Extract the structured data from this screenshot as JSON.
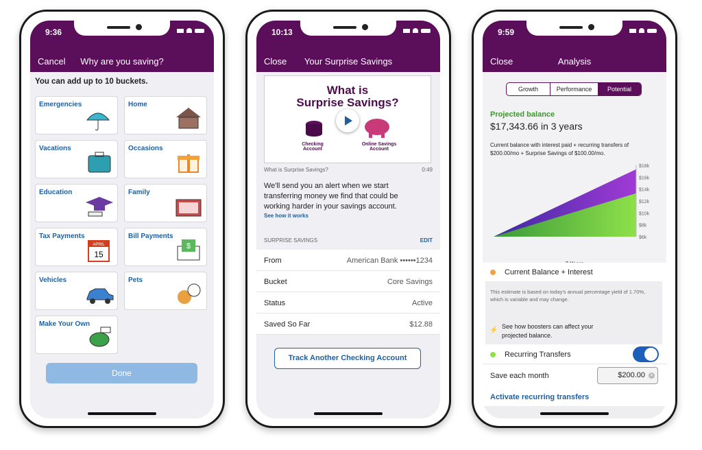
{
  "colors": {
    "brand": "#5b0f5b",
    "link": "#1f5f9e",
    "green": "#8ee04a",
    "purple": "#a23ad6",
    "orange": "#f2a23a",
    "toggle": "#1d5fb8"
  },
  "phone1": {
    "time": "9:36",
    "cancel": "Cancel",
    "title": "Why are you saving?",
    "intro": "You can add up to 10 buckets.",
    "buckets": [
      {
        "label": "Emergencies",
        "icon": "umbrella-icon"
      },
      {
        "label": "Home",
        "icon": "house-icon"
      },
      {
        "label": "Vacations",
        "icon": "suitcase-icon"
      },
      {
        "label": "Occasions",
        "icon": "gift-icon"
      },
      {
        "label": "Education",
        "icon": "graduation-cap-icon"
      },
      {
        "label": "Family",
        "icon": "family-photo-icon"
      },
      {
        "label": "Tax Payments",
        "icon": "calendar-icon",
        "calendar_month": "APRIL",
        "calendar_day": "15"
      },
      {
        "label": "Bill Payments",
        "icon": "envelope-dollar-icon"
      },
      {
        "label": "Vehicles",
        "icon": "car-icon"
      },
      {
        "label": "Pets",
        "icon": "pets-icon"
      },
      {
        "label": "Make Your Own",
        "icon": "piggy-bank-icon"
      }
    ],
    "done": "Done"
  },
  "phone2": {
    "time": "10:13",
    "close": "Close",
    "title": "Your Surprise Savings",
    "video": {
      "headline1": "What is",
      "headline2": "Surprise Savings?",
      "left_label": "Checking Account",
      "right_label": "Online Savings Account",
      "caption": "What is Surprise Savings?",
      "duration": "0:49"
    },
    "body": "We'll send you an alert when we start transferring money we find that could be working harder in your savings account.",
    "link": "See how it works",
    "section": "SURPRISE SAVINGS",
    "edit": "EDIT",
    "rows": [
      {
        "k": "From",
        "v": "American Bank ••••••1234"
      },
      {
        "k": "Bucket",
        "v": "Core Savings"
      },
      {
        "k": "Status",
        "v": "Active"
      },
      {
        "k": "Saved So Far",
        "v": "$12.88"
      }
    ],
    "button": "Track Another Checking Account"
  },
  "phone3": {
    "time": "9:59",
    "close": "Close",
    "title": "Analysis",
    "tabs": [
      "Growth",
      "Performance",
      "Potential"
    ],
    "active_tab": "Potential",
    "projected_label": "Projected balance",
    "projected_value": "$17,343.66 in 3 years",
    "description": "Current balance with interest paid + recurring transfers of $200.00/mo + Surprise Savings of $100.00/mo.",
    "legend1": "Current Balance + Interest",
    "disclaimer": "This estimate is based on today's annual percentage yield of 1.70%, which is variable and may change.",
    "boosters": "See how boosters can affect your projected balance.",
    "recurring": "Recurring Transfers",
    "recurring_on": true,
    "save_label": "Save each month",
    "save_value": "$200.00",
    "activate": "Activate recurring transfers"
  },
  "chart_data": {
    "type": "area",
    "x": [
      0,
      3
    ],
    "xlabel": "3 Years",
    "ylim": [
      6000,
      18000
    ],
    "yticks": [
      "$18k",
      "$16k",
      "$14k",
      "$12k",
      "$10k",
      "$8k",
      "$6k"
    ],
    "series": [
      {
        "color": "#8ee04a",
        "values": [
          6000,
          13300
        ]
      },
      {
        "color": "#a23ad6",
        "values": [
          6000,
          17343.66
        ]
      }
    ]
  }
}
